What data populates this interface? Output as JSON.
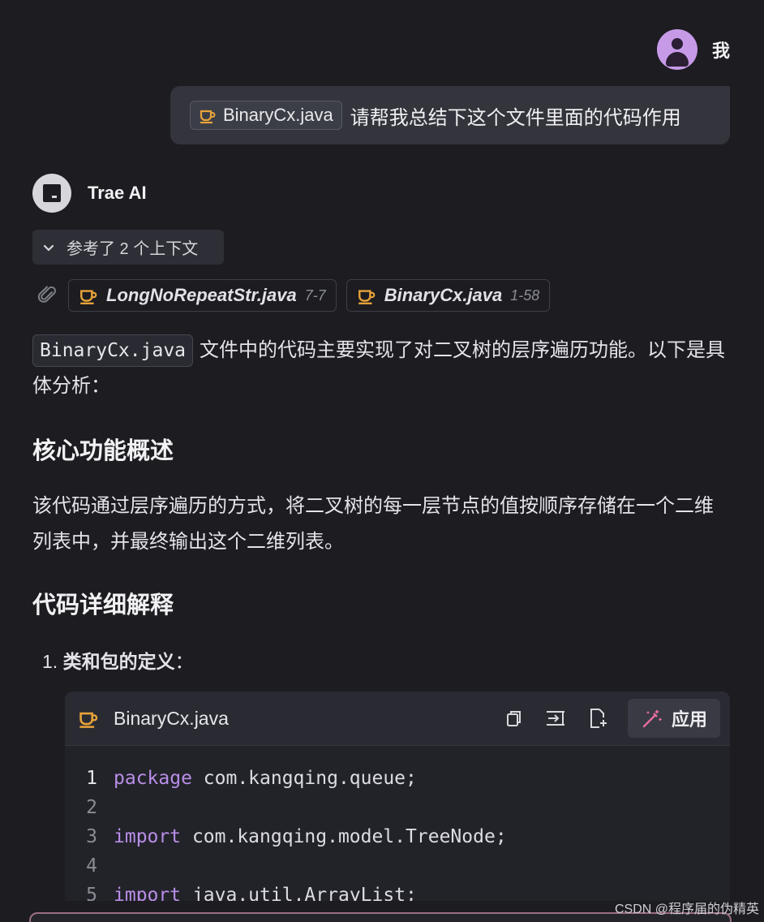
{
  "user": {
    "name": "我",
    "message": {
      "file_chip": "BinaryCx.java",
      "text": "请帮我总结下这个文件里面的代码作用"
    }
  },
  "ai": {
    "name": "Trae AI",
    "references": {
      "toggle_label": "参考了 2 个上下文",
      "items": [
        {
          "name": "LongNoRepeatStr.java",
          "range": "7-7"
        },
        {
          "name": "BinaryCx.java",
          "range": "1-58"
        }
      ]
    },
    "intro": {
      "code": "BinaryCx.java",
      "text": "文件中的代码主要实现了对二叉树的层序遍历功能。以下是具体分析："
    },
    "h_core": "核心功能概述",
    "core_text": "该代码通过层序遍历的方式，将二叉树的每一层节点的值按顺序存储在一个二维列表中，并最终输出这个二维列表。",
    "h_detail": "代码详细解释",
    "list_num": "1.",
    "list_item": "类和包的定义",
    "list_colon": "："
  },
  "code_block": {
    "filename": "BinaryCx.java",
    "apply_label": "应用",
    "lines": [
      {
        "num": "1",
        "kw": "package",
        "rest": " com.kangqing.queue;"
      },
      {
        "num": "2",
        "kw": "",
        "rest": ""
      },
      {
        "num": "3",
        "kw": "import",
        "rest": " com.kangqing.model.TreeNode;"
      },
      {
        "num": "4",
        "kw": "",
        "rest": ""
      },
      {
        "num": "5",
        "kw": "import",
        "rest": " java.util.ArrayList;"
      }
    ]
  },
  "watermark": "CSDN @程序届的伪精英",
  "colors": {
    "background": "#1c1c21",
    "java_icon": "#e8a33a",
    "keyword": "#b98ee8",
    "avatar": "#c79ae8"
  }
}
